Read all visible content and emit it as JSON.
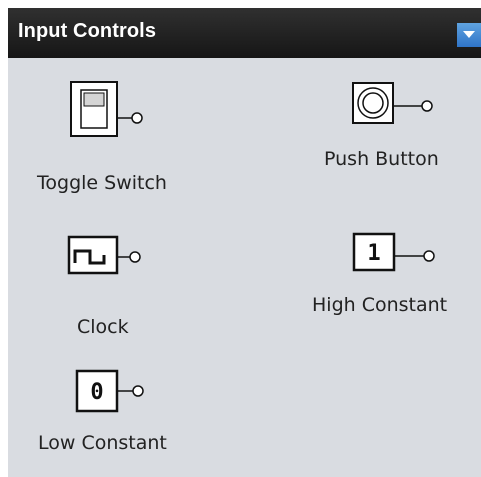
{
  "panel": {
    "title": "Input Controls",
    "menu_icon": "chevron-down-icon",
    "items": [
      {
        "label": "Toggle Switch",
        "icon": "toggle-switch-icon"
      },
      {
        "label": "Push Button",
        "icon": "push-button-icon"
      },
      {
        "label": "Clock",
        "icon": "clock-icon"
      },
      {
        "label": "High Constant",
        "icon": "high-constant-icon",
        "symbol": "1"
      },
      {
        "label": "Low Constant",
        "icon": "low-constant-icon",
        "symbol": "0"
      }
    ]
  }
}
